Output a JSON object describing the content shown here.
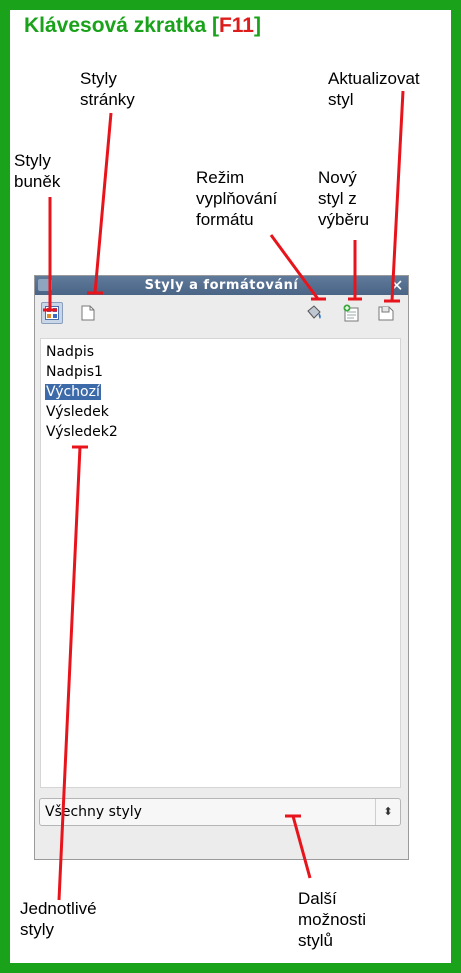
{
  "heading": {
    "prefix": "Klávesová zkratka [",
    "key": "F11",
    "suffix": "]"
  },
  "callouts": {
    "styly_stranky": "Styly\nstránky",
    "aktualizovat_styl": "Aktualizovat\nstyl",
    "styly_bunek": "Styly\nbuněk",
    "rezim_vyplnovani": "Režim\nvyplňování\nformátu",
    "novy_styl": "Nový\nstyl z\nvýběru",
    "jednotlive_styly": "Jednotlivé\nstyly",
    "dalsi_moznosti": "Další\nmožnosti\nstylů"
  },
  "dialog": {
    "title": "Styly a formátování",
    "close_glyph": "✕",
    "styles": [
      "Nadpis",
      "Nadpis1",
      "Výchozí",
      "Výsledek",
      "Výsledek2"
    ],
    "selected_index": 2,
    "filter_value": "Všechny styly",
    "filter_arrows": "▲▼"
  },
  "colors": {
    "frame": "#1aa31a",
    "key": "#dd1c1c",
    "callout_line": "#e8141b",
    "selection": "#3d6aa8"
  },
  "icons": [
    "cell-styles-icon",
    "page-styles-icon",
    "fill-format-mode-icon",
    "new-style-from-selection-icon",
    "update-style-icon"
  ]
}
